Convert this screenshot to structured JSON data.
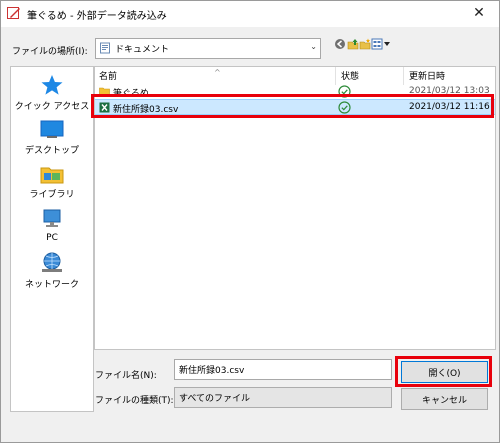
{
  "window": {
    "title": "筆ぐるめ - 外部データ読み込み"
  },
  "location": {
    "label": "ファイルの場所(I):",
    "value": "ドキュメント"
  },
  "places": [
    {
      "label": "クイック アクセス",
      "icon": "star-icon"
    },
    {
      "label": "デスクトップ",
      "icon": "desktop-icon"
    },
    {
      "label": "ライブラリ",
      "icon": "library-icon"
    },
    {
      "label": "PC",
      "icon": "pc-icon"
    },
    {
      "label": "ネットワーク",
      "icon": "network-icon"
    }
  ],
  "columns": {
    "name": "名前",
    "status": "状態",
    "modified": "更新日時"
  },
  "files": [
    {
      "name": "筆ぐるめ",
      "type": "folder",
      "status": "synced",
      "modified": "2021/03/12 13:03"
    },
    {
      "name": "新住所録03.csv",
      "type": "excel-csv",
      "status": "synced",
      "modified": "2021/03/12 11:16"
    }
  ],
  "filename": {
    "label": "ファイル名(N):",
    "value": "新住所録03.csv"
  },
  "filetype": {
    "label": "ファイルの種類(T):",
    "value": "すべてのファイル"
  },
  "buttons": {
    "open": "開く(O)",
    "cancel": "キャンセル"
  },
  "colors": {
    "highlight": "#e8000b",
    "selection": "#cce8ff",
    "status_ok": "#2e8b3a"
  }
}
